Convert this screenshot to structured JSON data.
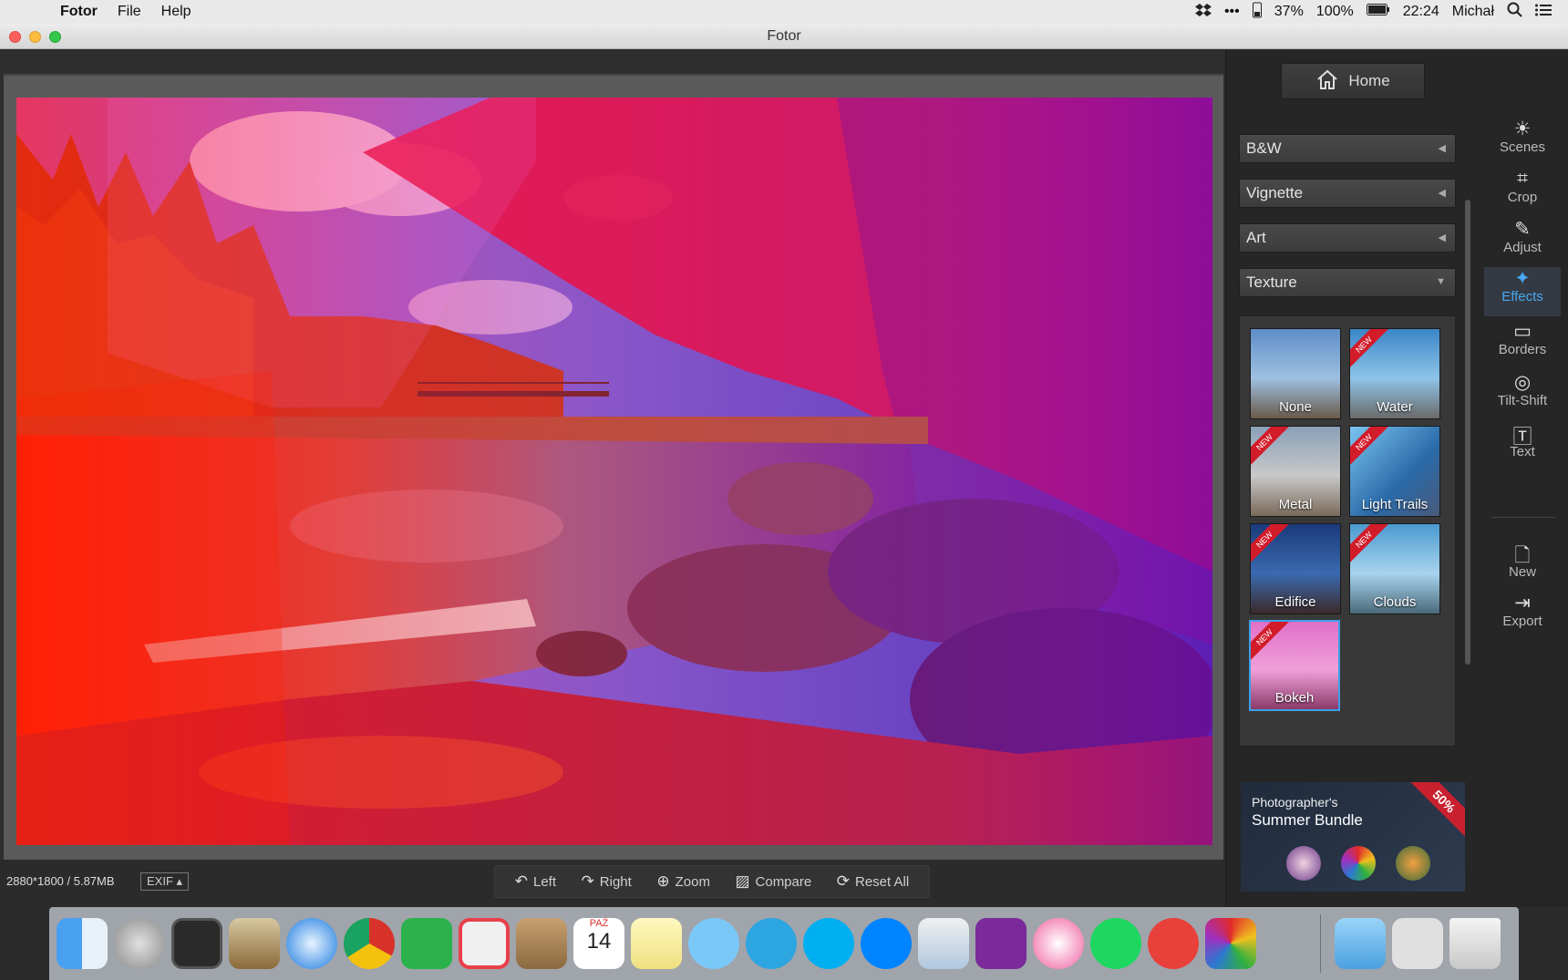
{
  "menubar": {
    "app_name": "Fotor",
    "menus": [
      "File",
      "Help"
    ],
    "battery_left": "37%",
    "battery_right": "100%",
    "clock": "22:24",
    "user": "Michał"
  },
  "window": {
    "title": "Fotor"
  },
  "statusbar": {
    "dimensions": "2880*1800 / 5.87MB",
    "exif_label": "EXIF"
  },
  "toolbar": {
    "left": "Left",
    "right": "Right",
    "zoom": "Zoom",
    "compare": "Compare",
    "reset_all": "Reset All"
  },
  "panel": {
    "home": "Home",
    "sections": [
      "B&W",
      "Vignette",
      "Art",
      "Texture"
    ],
    "textures": [
      {
        "label": "None",
        "new": false,
        "selected": false
      },
      {
        "label": "Water",
        "new": true,
        "selected": false
      },
      {
        "label": "Metal",
        "new": true,
        "selected": false
      },
      {
        "label": "Light Trails",
        "new": true,
        "selected": false
      },
      {
        "label": "Edifice",
        "new": true,
        "selected": false
      },
      {
        "label": "Clouds",
        "new": true,
        "selected": false
      },
      {
        "label": "Bokeh",
        "new": true,
        "selected": true
      }
    ],
    "new_badge": "NEW",
    "promo": {
      "line1": "Photographer's",
      "line2": "Summer Bundle",
      "badge": "50%"
    }
  },
  "sidebar": {
    "items": [
      "Scenes",
      "Crop",
      "Adjust",
      "Effects",
      "Borders",
      "Tilt-Shift",
      "Text",
      "New",
      "Export"
    ],
    "active": "Effects"
  },
  "dock": {
    "calendar_month": "PAŹ",
    "calendar_day": "14"
  },
  "colors": {
    "accent": "#4aa7f0",
    "new_badge": "#d21c2a"
  }
}
